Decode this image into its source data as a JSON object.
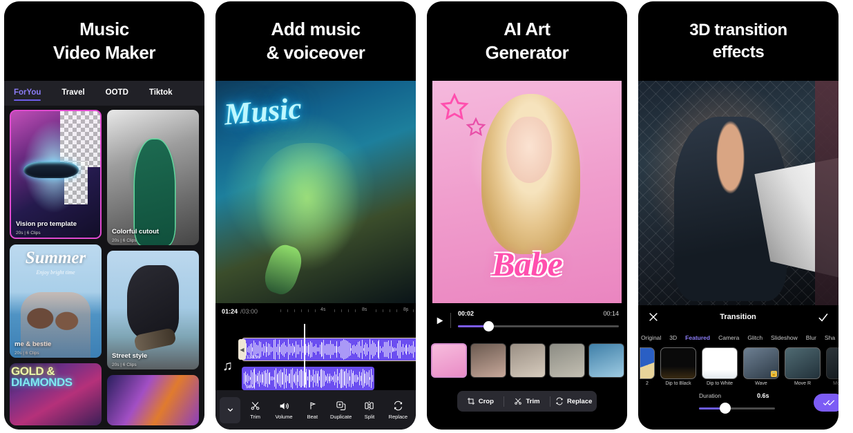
{
  "panels": [
    {
      "id": "music-video-maker",
      "headline": [
        "Music",
        "Video Maker"
      ],
      "tabs": [
        {
          "label": "ForYou",
          "active": true
        },
        {
          "label": "Travel",
          "active": false
        },
        {
          "label": "OOTD",
          "active": false
        },
        {
          "label": "Tiktok",
          "active": false
        }
      ],
      "templates": [
        {
          "title": "Vision pro template",
          "meta": "20s  |  6 Clips"
        },
        {
          "title": "Colorful cutout",
          "meta": "20s  |  6 Clips"
        },
        {
          "title": "me & bestie",
          "meta": "20s  |  6 Clips"
        },
        {
          "title": "Street style",
          "meta": "20s  |  6 Clips"
        }
      ],
      "summer_card": {
        "word": "Summer",
        "sub": "Enjoy bright time"
      },
      "gold_card": {
        "line1": "GOLD &",
        "line2": "DIAMONDS"
      }
    },
    {
      "id": "add-music-voiceover",
      "headline": [
        "Add music",
        "& voiceover"
      ],
      "neon_text": "Music",
      "time_current": "01:24",
      "time_total": "/03:00",
      "ruler_ticks": [
        "4s",
        "8s",
        "8s"
      ],
      "tracks": [
        {
          "label": "138.9s"
        },
        {
          "label": "56s"
        }
      ],
      "toolbar": [
        {
          "icon": "chevron-down-icon",
          "label": ""
        },
        {
          "icon": "scissors-icon",
          "label": "Trim"
        },
        {
          "icon": "speaker-icon",
          "label": "Volume"
        },
        {
          "icon": "beat-icon",
          "label": "Beat"
        },
        {
          "icon": "duplicate-icon",
          "label": "Duplicate"
        },
        {
          "icon": "split-icon",
          "label": "Split"
        },
        {
          "icon": "replace-icon",
          "label": "Replace"
        }
      ]
    },
    {
      "id": "ai-art-generator",
      "headline": [
        "AI Art",
        "Generator"
      ],
      "art_word": "Babe",
      "time_current": "00:02",
      "time_total": "00:14",
      "actions": [
        {
          "icon": "crop-icon",
          "label": "Crop"
        },
        {
          "icon": "scissors-icon",
          "label": "Trim"
        },
        {
          "icon": "replace-icon",
          "label": "Replace"
        }
      ]
    },
    {
      "id": "3d-transition-effects",
      "headline": [
        "3D transition",
        "effects"
      ],
      "panel_title": "Transition",
      "tabs": [
        {
          "label": "Original",
          "active": false
        },
        {
          "label": "3D",
          "active": false
        },
        {
          "label": "Featured",
          "active": true
        },
        {
          "label": "Camera",
          "active": false
        },
        {
          "label": "Glitch",
          "active": false
        },
        {
          "label": "Slideshow",
          "active": false
        },
        {
          "label": "Blur",
          "active": false
        },
        {
          "label": "Sha",
          "active": false
        }
      ],
      "transitions": [
        {
          "name": "2",
          "locked": false
        },
        {
          "name": "Dip to Black",
          "locked": false
        },
        {
          "name": "Dip to White",
          "locked": false
        },
        {
          "name": "Wave",
          "locked": true
        },
        {
          "name": "Move R",
          "locked": false
        },
        {
          "name": "Mo",
          "locked": false
        }
      ],
      "duration_label": "Duration",
      "duration_value": "0.6s",
      "apply_all_icon": "apply-all-icon"
    }
  ],
  "colors": {
    "accent_purple": "#7c5cf5",
    "tab_active": "#8b7cf6",
    "pink": "#ff4fae",
    "panel_bg": "#000000"
  }
}
